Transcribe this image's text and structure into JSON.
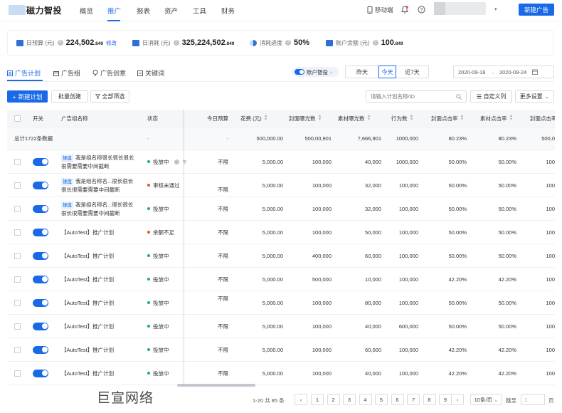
{
  "nav": {
    "logo_text": "磁力智投",
    "items": [
      "概览",
      "推广",
      "报表",
      "资产",
      "工具",
      "财务"
    ],
    "active_index": 1,
    "mobile_label": "移动端",
    "new_ad_button": "新建广告"
  },
  "stats": [
    {
      "label": "日预算 (元)",
      "value": "224,502",
      "decimals": ".849",
      "link": "修改",
      "icon": "wallet-icon"
    },
    {
      "label": "日消耗 (元)",
      "value": "325,224,502",
      "decimals": ".849",
      "icon": "card-icon"
    },
    {
      "label": "消耗进度",
      "value": "50%",
      "decimals": "",
      "icon": "pie-icon"
    },
    {
      "label": "账户余额 (元)",
      "value": "100",
      "decimals": ".849",
      "icon": "wallet-icon"
    }
  ],
  "tabs": [
    {
      "label": "广告计划",
      "icon": "plan-icon"
    },
    {
      "label": "广告组",
      "icon": "group-icon"
    },
    {
      "label": "广告创意",
      "icon": "bulb-icon"
    },
    {
      "label": "关键词",
      "icon": "keyword-icon"
    }
  ],
  "smart_toggle": "账户智投",
  "range_buttons": [
    "昨天",
    "今天",
    "近7天"
  ],
  "range_active": 1,
  "date_start": "2020-09-18",
  "date_end": "2020-09-24",
  "toolbar": {
    "new_plan": "新建计划",
    "batch_create": "批量创建",
    "filter": "全部筛选",
    "search_placeholder": "请输入计划名称/ID",
    "custom_columns": "自定义列",
    "more_settings": "更多设置"
  },
  "table": {
    "headers": [
      "开关",
      "广告组名称",
      "状态",
      "今日预算",
      "花费 (元)",
      "封面曝光数",
      "素材曝光数",
      "行为数",
      "封面点击率",
      "素材点击率",
      "封面点击率"
    ],
    "summary": {
      "label": "总计1722条数据",
      "status": "-",
      "budget": "-",
      "spend": "500,000.00",
      "cover_exposure": "500,00,901",
      "material_exposure": "7,666,901",
      "actions": "1000,000",
      "cover_ctr": "80.23%",
      "material_ctr": "80.23%",
      "extra": "500,0"
    },
    "rows": [
      {
        "tag": "操盘",
        "name": "我是组名称很长很长很长很需要需要中间截断",
        "status": "投放中",
        "status_color": "#19b36b",
        "study": "学",
        "budget": "不限",
        "spend": "5,000.00",
        "cover": "100,000",
        "material": "40,000",
        "actions": "1000,000",
        "cctr": "50.00%",
        "mctr": "50.00%",
        "extra": "100"
      },
      {
        "tag": "操盘",
        "name": "我是组名称名...很长很长很长很需要需要中间截断",
        "status": "审核未通过",
        "status_color": "#f04c3b",
        "budget": "不限",
        "spend": "5,000.00",
        "cover": "100,000",
        "material": "32,000",
        "actions": "100,000",
        "cctr": "50.00%",
        "mctr": "50.00%",
        "extra": "100"
      },
      {
        "tag": "操盘",
        "name": "我是组名称名...很长很长很长很需要需要中间截断",
        "status": "投放中",
        "status_color": "#19b36b",
        "budget": "不限",
        "spend": "5,000.00",
        "cover": "100,000",
        "material": "32,000",
        "actions": "100,000",
        "cctr": "50.00%",
        "mctr": "50.00%",
        "extra": "100"
      },
      {
        "name": "【AutoTest】推广计划",
        "status": "余额不足",
        "status_color": "#f04c3b",
        "budget": "不限",
        "spend": "5,000.00",
        "cover": "100,000",
        "material": "50,000",
        "actions": "100,000",
        "cctr": "50.00%",
        "mctr": "50.00%",
        "extra": "100"
      },
      {
        "name": "【AutoTest】推广计划",
        "status": "投放中",
        "status_color": "#19b36b",
        "budget": "不限",
        "spend": "5,000.00",
        "cover": "400,000",
        "material": "60,000",
        "actions": "100,000",
        "cctr": "50.00%",
        "mctr": "50.00%",
        "extra": "100"
      },
      {
        "name": "【AutoTest】推广计划",
        "status": "投放中",
        "status_color": "#19b36b",
        "budget": "不限",
        "spend": "5,000.00",
        "cover": "500,000",
        "material": "10,000",
        "actions": "100,000",
        "cctr": "42.20%",
        "mctr": "42.20%",
        "extra": "100"
      },
      {
        "name": "【AutoTest】推广计划",
        "status": "投放中",
        "status_color": "#19b36b",
        "budget": "不限",
        "spend": "5,000.00",
        "cover": "100,000",
        "material": "80,000",
        "actions": "100,000",
        "cctr": "50.00%",
        "mctr": "50.00%",
        "extra": "100"
      },
      {
        "name": "【AutoTest】推广计划",
        "status": "投放中",
        "status_color": "#19b36b",
        "budget": "不限",
        "spend": "5,000.00",
        "cover": "100,000",
        "material": "40,000",
        "actions": "600,000",
        "cctr": "50.00%",
        "mctr": "50.00%",
        "extra": "100"
      },
      {
        "name": "【AutoTest】推广计划",
        "status": "投放中",
        "status_color": "#19b36b",
        "budget": "不限",
        "spend": "5,000.00",
        "cover": "100,000",
        "material": "60,000",
        "actions": "100,000",
        "cctr": "42.20%",
        "mctr": "42.20%",
        "extra": "100"
      },
      {
        "name": "【AutoTest】推广计划",
        "status": "投放中",
        "status_color": "#19b36b",
        "budget": "不限",
        "spend": "5,000.00",
        "cover": "100,000",
        "material": "40,000",
        "actions": "100,000",
        "cctr": "42.20%",
        "mctr": "42.20%",
        "extra": "100"
      }
    ]
  },
  "watermark": "巨宣网络",
  "pagination": {
    "summary": "1-20 共 85 条",
    "pages": [
      "1",
      "2",
      "3",
      "4",
      "5",
      "6",
      "7",
      "8",
      "9"
    ],
    "page_size": "10条/页",
    "jump_label": "跳至",
    "jump_value": "1",
    "page_unit": "页"
  },
  "colors": {
    "primary": "#1a6ae8",
    "running": "#19b36b",
    "error": "#f04c3b"
  }
}
